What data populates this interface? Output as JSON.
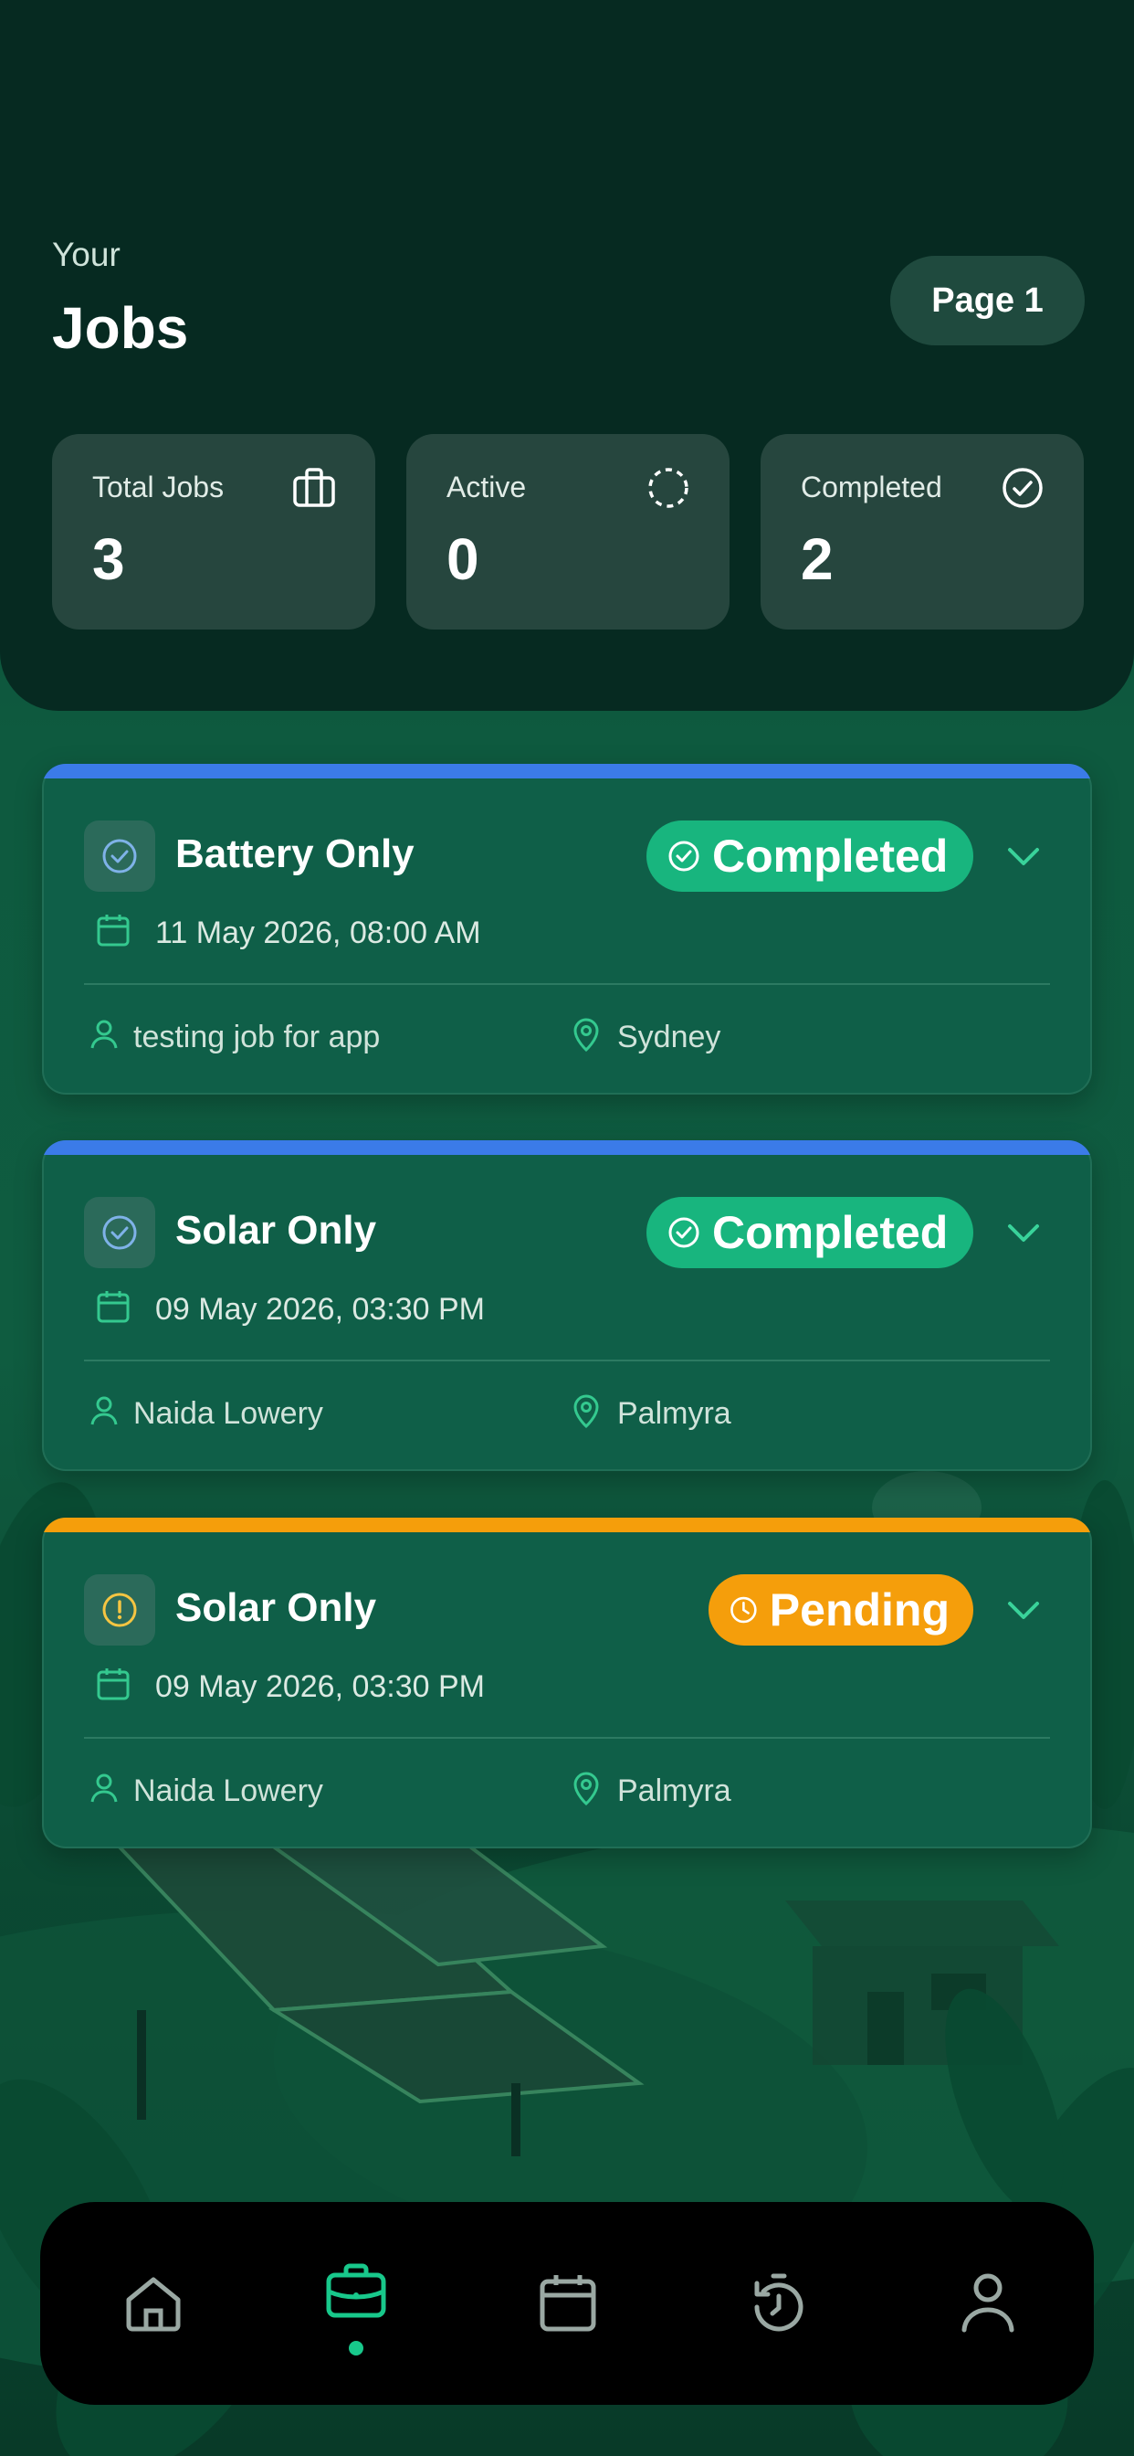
{
  "header": {
    "subtitle": "Your",
    "title": "Jobs",
    "page_label": "Page 1"
  },
  "stats": [
    {
      "label": "Total Jobs",
      "value": "3",
      "icon": "briefcase-icon"
    },
    {
      "label": "Active",
      "value": "0",
      "icon": "dashed-circle-icon"
    },
    {
      "label": "Completed",
      "value": "2",
      "icon": "check-circle-icon"
    }
  ],
  "jobs": [
    {
      "title": "Battery Only",
      "status": "Completed",
      "status_color": "#18b57e",
      "accent_color": "#3b7be8",
      "status_icon": "check-circle-icon",
      "datetime": "11 May 2026, 08:00 AM",
      "person": "testing job for app",
      "location": "Sydney"
    },
    {
      "title": "Solar Only",
      "status": "Completed",
      "status_color": "#18b57e",
      "accent_color": "#3b7be8",
      "status_icon": "check-circle-icon",
      "datetime": "09 May 2026, 03:30 PM",
      "person": "Naida Lowery",
      "location": "Palmyra"
    },
    {
      "title": "Solar Only",
      "status": "Pending",
      "status_color": "#f59e0b",
      "accent_color": "#f59e0b",
      "status_icon": "alert-circle-icon",
      "datetime": "09 May 2026, 03:30 PM",
      "person": "Naida Lowery",
      "location": "Palmyra"
    }
  ],
  "nav": {
    "items": [
      {
        "icon": "home-icon",
        "active": false
      },
      {
        "icon": "briefcase-icon",
        "active": true
      },
      {
        "icon": "calendar-icon",
        "active": false
      },
      {
        "icon": "timer-history-icon",
        "active": false
      },
      {
        "icon": "profile-icon",
        "active": false
      }
    ],
    "active_color": "#18c88b",
    "inactive_color": "#9aa8a3"
  }
}
